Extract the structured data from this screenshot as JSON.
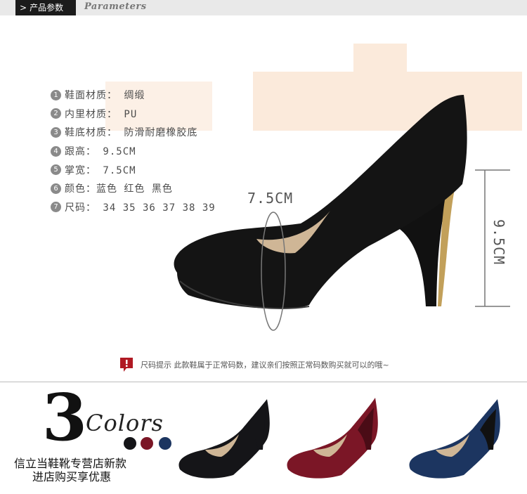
{
  "header": {
    "chevron": ">",
    "tab_label": "产品参数",
    "subtitle": "Parameters"
  },
  "specs": [
    {
      "num": "1",
      "text": "鞋面材质： 绸缎"
    },
    {
      "num": "2",
      "text": "内里材质： PU"
    },
    {
      "num": "3",
      "text": "鞋底材质： 防滑耐磨橡胶底"
    },
    {
      "num": "4",
      "text": "跟高： 9.5CM"
    },
    {
      "num": "5",
      "text": "掌宽： 7.5CM"
    },
    {
      "num": "6",
      "text": "颜色：蓝色 红色 黑色"
    },
    {
      "num": "7",
      "text": "尺码： 34 35 36 37 38 39"
    }
  ],
  "dimensions": {
    "width_label": "7.5CM",
    "height_label": "9.5CM"
  },
  "size_tip": {
    "icon": "warning-flag-icon",
    "text": "尺码提示 此款鞋属于正常码数，建议亲们按照正常码数购买就可以的哦~"
  },
  "colors_section": {
    "count": "3",
    "word": "Colors"
  },
  "variants": [
    {
      "name": "black",
      "color": "#151518"
    },
    {
      "name": "red",
      "color": "#7b1626"
    },
    {
      "name": "blue",
      "color": "#1c3560"
    }
  ],
  "store_overlay": {
    "line1": "信立当鞋靴专营店新款",
    "line2": "进店购买享优惠"
  },
  "colors": {
    "header_tab_bg": "#1b1b1b",
    "header_bar_bg": "#e9e9e9",
    "accent_red": "#b01923"
  }
}
